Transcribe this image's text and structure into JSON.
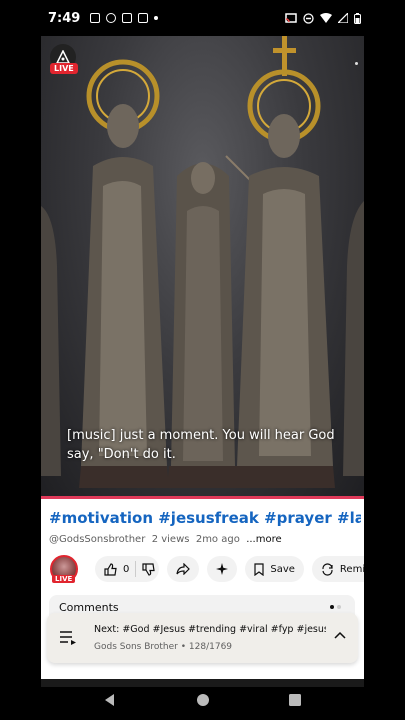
{
  "status_bar": {
    "time": "7:49",
    "icons": [
      "facebook-icon",
      "messenger-icon",
      "facebook-icon",
      "facebook-icon",
      "dot-icon",
      "cast-icon",
      "dnd-icon",
      "wifi-icon",
      "signal-icon",
      "battery-icon"
    ]
  },
  "video": {
    "live_badge": "LIVE",
    "caption": "[music] just a moment. You will hear God say, \"Don't do it.",
    "progress_color": "#e03a5a"
  },
  "info": {
    "title": "#motivation #jesusfreak #prayer #lawofa..",
    "channel": "@GodsSonsbrother",
    "views": "2 views",
    "age": "2mo ago",
    "more": "...more",
    "avatar_live": "LIVE",
    "like_count": "0",
    "save_label": "Save",
    "remix_label": "Remix",
    "title_color": "#1565c0"
  },
  "comments": {
    "label": "Comments"
  },
  "up_next": {
    "title": "Next: #God #Jesus #trending #viral #fyp #jesusc...",
    "subtitle": "Gods Sons Brother • 128/1769"
  },
  "nav": {
    "icons": [
      "back-icon",
      "home-icon",
      "recents-icon"
    ]
  }
}
